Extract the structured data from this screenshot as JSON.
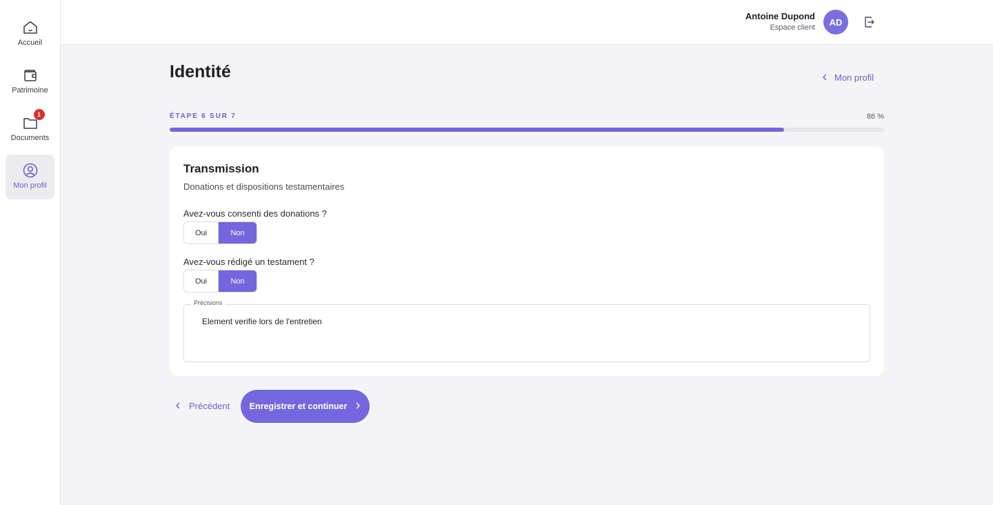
{
  "sidebar": {
    "items": [
      {
        "label": "Accueil",
        "icon": "home-icon"
      },
      {
        "label": "Patrimoine",
        "icon": "wallet-icon"
      },
      {
        "label": "Documents",
        "icon": "folder-icon",
        "badge": "1"
      },
      {
        "label": "Mon profil",
        "icon": "user-circle-icon",
        "active": true
      }
    ]
  },
  "header": {
    "user_name": "Antoine Dupond",
    "user_role": "Espace client",
    "avatar_initials": "AD"
  },
  "main": {
    "title": "Identité",
    "back_link": "Mon profil",
    "step_label": "ÉTAPE 6 SUR 7",
    "step_percent_text": "86 %",
    "progress": 0.86,
    "card": {
      "title": "Transmission",
      "subtitle": "Donations et dispositions testamentaires",
      "questions": [
        {
          "label": "Avez-vous consenti des donations ?",
          "yes": "Oui",
          "no": "Non",
          "selected": "Non"
        },
        {
          "label": "Avez-vous rédigé un testament ?",
          "yes": "Oui",
          "no": "Non",
          "selected": "Non"
        }
      ],
      "details": {
        "label": "Précisions",
        "value": "Element verifie lors de l'entretien"
      }
    },
    "prev_label": "Précédent",
    "save_label": "Enregistrer et continuer"
  },
  "colors": {
    "accent": "#7466de",
    "badge": "#d93030"
  }
}
